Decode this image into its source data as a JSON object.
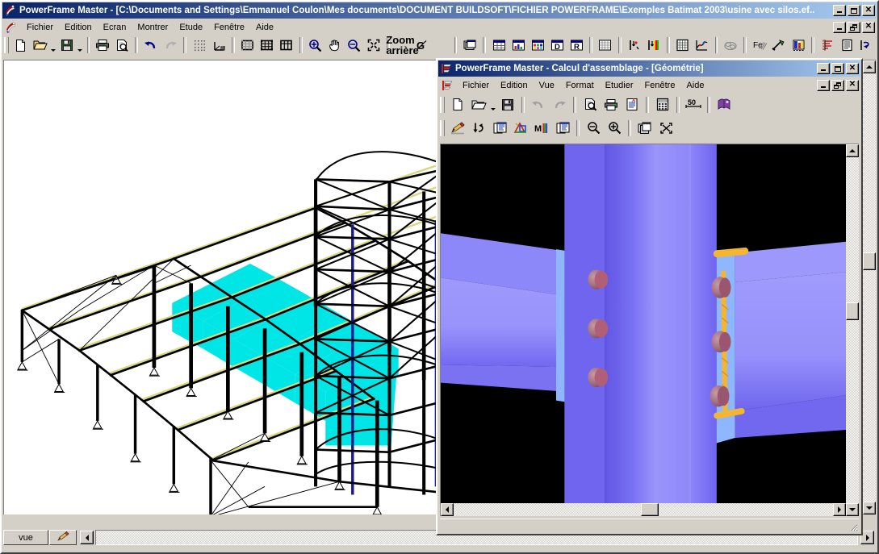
{
  "app": {
    "title": "PowerFrame Master - [C:\\Documents and Settings\\Emmanuel Coulon\\Mes documents\\DOCUMENT BUILDSOFT\\FICHIER POWERFRAME\\Exemples Batimat 2003\\usine avec silos.ef..",
    "icon": "powerframe-logo-icon",
    "window_buttons": {
      "minimize": "_",
      "maximize": "□",
      "close": "✕"
    },
    "mdi_buttons": {
      "minimize": "_",
      "restore": "❐",
      "close": "✕"
    },
    "menu": [
      {
        "label": "Fichier"
      },
      {
        "label": "Edition"
      },
      {
        "label": "Ecran"
      },
      {
        "label": "Montrer"
      },
      {
        "label": "Etude"
      },
      {
        "label": "Fenêtre"
      },
      {
        "label": "Aide"
      }
    ],
    "toolbar": [
      {
        "name": "new-file-button",
        "icon": "new-document-icon",
        "label": "Nouveau"
      },
      {
        "name": "open-file-button",
        "icon": "open-folder-icon",
        "label": "Ouvrir"
      },
      {
        "name": "open-file-dropdown",
        "icon": "chevron-down-icon",
        "label": ""
      },
      {
        "name": "save-file-button",
        "icon": "floppy-disk-icon",
        "label": "Enregistrer"
      },
      {
        "name": "save-file-dropdown",
        "icon": "chevron-down-icon",
        "label": ""
      },
      {
        "sep": true
      },
      {
        "name": "print-button",
        "icon": "printer-icon",
        "label": "Imprimer"
      },
      {
        "name": "print-preview-button",
        "icon": "print-preview-icon",
        "label": "Aperçu"
      },
      {
        "sep": true
      },
      {
        "name": "undo-button",
        "icon": "undo-arrow-icon",
        "label": "Annuler"
      },
      {
        "name": "redo-button",
        "icon": "redo-arrow-icon",
        "label": "Rétablir"
      },
      {
        "sep": true
      },
      {
        "name": "grid-points-button",
        "icon": "grid-dots-icon",
        "label": "Grille"
      },
      {
        "name": "axis-system-button",
        "icon": "axis-system-icon",
        "label": "Axes"
      },
      {
        "sep": true
      },
      {
        "name": "mesh-1-button",
        "icon": "mesh-frame-icon",
        "label": "Maillage"
      },
      {
        "name": "mesh-2-button",
        "icon": "mesh-nodes-icon",
        "label": "Noeuds"
      },
      {
        "name": "mesh-3-button",
        "icon": "mesh-plain-icon",
        "label": "Trame"
      },
      {
        "sep": true
      },
      {
        "name": "zoom-in-button",
        "icon": "zoom-in-icon",
        "label": "Zoom avant"
      },
      {
        "name": "pan-button",
        "icon": "hand-pan-icon",
        "label": "Déplacer"
      },
      {
        "name": "zoom-out-button",
        "icon": "zoom-out-icon",
        "label": "Zoom arrière"
      },
      {
        "name": "zoom-fit-button",
        "icon": "zoom-fit-icon",
        "label": "Ajuster"
      },
      {
        "sep": true
      },
      {
        "name": "geometry-g-button",
        "icon": "letter-g-icon",
        "label": "G"
      },
      {
        "name": "geometry-g-cross-button",
        "icon": "letter-g-crossed-icon",
        "label": "G"
      },
      {
        "name": "text-t-button",
        "icon": "letter-t-icon",
        "label": "T"
      },
      {
        "sep": true
      },
      {
        "name": "layers-button",
        "icon": "layers-stack-icon",
        "label": "Couches"
      },
      {
        "sep": true
      },
      {
        "name": "table-window-button",
        "icon": "table-window-icon",
        "label": "Tableau"
      },
      {
        "name": "chart-window-button",
        "icon": "chart-window-icon",
        "label": "Graphique"
      },
      {
        "name": "color-window-button",
        "icon": "color-window-icon",
        "label": "Couleurs"
      },
      {
        "name": "deform-window-button",
        "icon": "letter-d-window-icon",
        "label": "D"
      },
      {
        "name": "result-window-button",
        "icon": "letter-r-window-icon",
        "label": "R"
      },
      {
        "sep": true
      },
      {
        "name": "spreadsheet-button",
        "icon": "spreadsheet-icon",
        "label": "Feuille"
      },
      {
        "sep": true
      },
      {
        "name": "node-load-button",
        "icon": "node-load-icon",
        "label": "Charges"
      },
      {
        "name": "color-load-button",
        "icon": "color-scale-load-icon",
        "label": "Échelle"
      },
      {
        "sep": true
      },
      {
        "name": "calc-grid-button",
        "icon": "calculation-grid-icon",
        "label": "Calcul"
      },
      {
        "name": "analysis-button",
        "icon": "analysis-scribble-icon",
        "label": "Analyse"
      },
      {
        "sep": true
      },
      {
        "name": "mass-button",
        "icon": "cloud-mass-icon",
        "label": "Masse"
      },
      {
        "sep": true
      },
      {
        "name": "steel-fe-button",
        "icon": "steel-fe-icon",
        "label": "Fe"
      },
      {
        "name": "connection-button",
        "icon": "connection-tool-icon",
        "label": "Assemblage"
      },
      {
        "name": "section-color-button",
        "icon": "section-color-icon",
        "label": "Sections"
      },
      {
        "sep": true
      },
      {
        "name": "diagram-button",
        "icon": "diagram-bars-icon",
        "label": "Diagramme"
      },
      {
        "name": "report-button",
        "icon": "report-document-icon",
        "label": "Rapport"
      },
      {
        "name": "exchange-button",
        "icon": "exchange-arrows-icon",
        "label": "Échange"
      }
    ],
    "status": {
      "tabs": [
        {
          "name": "tab-vue",
          "label": "vue",
          "icon": ""
        },
        {
          "name": "tab-edit",
          "label": "",
          "icon": "pencil-icon"
        }
      ],
      "scroll_left": "◀",
      "scroll_right": "▶"
    },
    "model": {
      "description": "Vue 3D filaire d'une ossature métallique industrielle avec silos",
      "highlight_color": "#00E5E5",
      "line_color": "#000000",
      "accent_color": "#1a1a8c",
      "member_color": "#E8E890",
      "background": "#FFFFFF"
    }
  },
  "child": {
    "title": "PowerFrame Master - Calcul d'assemblage - [Géométrie]",
    "icon": "powerframe-connection-icon",
    "window_buttons": {
      "minimize": "_",
      "maximize": "□",
      "close": "✕"
    },
    "mdi_buttons": {
      "minimize": "_",
      "restore": "❐",
      "close": "✕"
    },
    "menu": [
      {
        "label": "Fichier"
      },
      {
        "label": "Edition"
      },
      {
        "label": "Vue"
      },
      {
        "label": "Format"
      },
      {
        "label": "Etudier"
      },
      {
        "label": "Fenêtre"
      },
      {
        "label": "Aide"
      }
    ],
    "toolbar_top": [
      {
        "name": "new-file-button",
        "icon": "new-document-icon",
        "label": "Nouveau"
      },
      {
        "name": "open-file-button",
        "icon": "open-folder-icon",
        "label": "Ouvrir"
      },
      {
        "name": "open-file-dropdown",
        "icon": "chevron-down-icon",
        "label": ""
      },
      {
        "name": "save-file-button",
        "icon": "floppy-disk-icon",
        "label": "Enregistrer"
      },
      {
        "sep": true
      },
      {
        "name": "undo-button",
        "icon": "undo-arrow-icon",
        "label": "Annuler"
      },
      {
        "name": "redo-button",
        "icon": "redo-arrow-icon",
        "label": "Rétablir"
      },
      {
        "sep": true
      },
      {
        "name": "print-preview-button",
        "icon": "print-preview-icon",
        "label": "Aperçu"
      },
      {
        "name": "print-button",
        "icon": "printer-icon",
        "label": "Imprimer"
      },
      {
        "name": "text-report-button",
        "icon": "text-report-icon",
        "label": "Note de calcul"
      },
      {
        "sep": true
      },
      {
        "name": "calculator-button",
        "icon": "calculator-icon",
        "label": "Calculatrice"
      },
      {
        "sep": true
      },
      {
        "name": "scale-button",
        "icon": "scale-50-icon",
        "label": "50"
      },
      {
        "sep": true
      },
      {
        "name": "help-book-button",
        "icon": "help-book-icon",
        "label": "Aide"
      }
    ],
    "toolbar_bottom": [
      {
        "name": "edit-pencil-button",
        "icon": "pencil-edit-icon",
        "label": "Éditer"
      },
      {
        "name": "flip-button",
        "icon": "flip-arrow-icon",
        "label": "Inverser"
      },
      {
        "name": "copy-data-button",
        "icon": "copy-data-icon",
        "label": "Copier"
      },
      {
        "name": "geometry-button",
        "icon": "geometry-shapes-icon",
        "label": "Géométrie"
      },
      {
        "name": "results-color-button",
        "icon": "results-color-icon",
        "label": "Résultats"
      },
      {
        "name": "paste-data-button",
        "icon": "paste-data-icon",
        "label": "Coller"
      },
      {
        "sep": true
      },
      {
        "name": "zoom-out-button",
        "icon": "zoom-out-icon",
        "label": "Zoom arrière"
      },
      {
        "name": "zoom-in-button",
        "icon": "zoom-in-icon",
        "label": "Zoom avant"
      },
      {
        "sep": true
      },
      {
        "name": "layers-button",
        "icon": "layers-stack-icon",
        "label": "Couches"
      },
      {
        "name": "fit-view-button",
        "icon": "fit-view-icon",
        "label": "Ajuster"
      }
    ],
    "canvas": {
      "description": "Rendu 3D ombré d'un assemblage poutre-poteau boulonné avec platine d'about et soudures",
      "background": "#000000",
      "steel_light": "#9A95FA",
      "steel_mid": "#7A72F2",
      "steel_dark": "#6258E8",
      "plate_edge": "#8FB7FF",
      "bolt_color": "#A06070",
      "weld_color": "#F2B632"
    },
    "scrollbars": {
      "vertical": "visible",
      "horizontal": "visible"
    }
  }
}
